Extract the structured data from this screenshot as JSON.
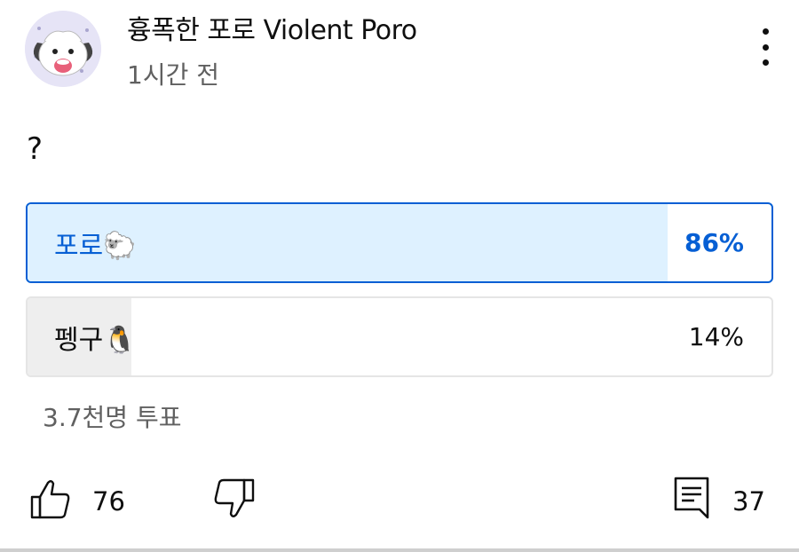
{
  "post": {
    "author": "흉폭한 포로 Violent Poro",
    "time": "1시간 전",
    "text": "?"
  },
  "poll": {
    "options": [
      {
        "label": "포로🐑",
        "percent": "86%",
        "fraction": 0.86,
        "selected": true
      },
      {
        "label": "펭구🐧",
        "percent": "14%",
        "fraction": 0.14,
        "selected": false
      }
    ],
    "votes": "3.7천명 투표"
  },
  "actions": {
    "like_count": "76",
    "comment_count": "37"
  },
  "icons": {
    "avatar": "poro-avatar",
    "more": "more-vert-icon",
    "like": "thumbs-up-icon",
    "dislike": "thumbs-down-icon",
    "comment": "comment-icon"
  },
  "colors": {
    "accent": "#065fd4",
    "selected_fill": "#def1ff",
    "unselected_fill": "#eeeeee",
    "secondary_text": "#606060"
  }
}
